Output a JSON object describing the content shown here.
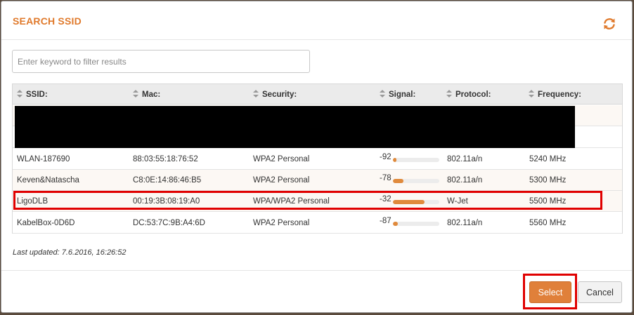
{
  "dialog": {
    "title": "SEARCH SSID",
    "filter_placeholder": "Enter keyword to filter results",
    "columns": {
      "ssid": "SSID:",
      "mac": "Mac:",
      "security": "Security:",
      "signal": "Signal:",
      "protocol": "Protocol:",
      "frequency": "Frequency:"
    },
    "rows": [
      {
        "ssid": "WLAN-187690",
        "mac": "88:03:55:18:76:52",
        "security": "WPA2 Personal",
        "signal": "-92",
        "signal_fill": 0.08,
        "protocol": "802.11a/n",
        "frequency": "5240 MHz"
      },
      {
        "ssid": "Keven&Natascha",
        "mac": "C8:0E:14:86:46:B5",
        "security": "WPA2 Personal",
        "signal": "-78",
        "signal_fill": 0.22,
        "protocol": "802.11a/n",
        "frequency": "5300 MHz"
      },
      {
        "ssid": "LigoDLB",
        "mac": "00:19:3B:08:19:A0",
        "security": "WPA/WPA2 Personal",
        "signal": "-32",
        "signal_fill": 0.68,
        "protocol": "W-Jet",
        "frequency": "5500 MHz"
      },
      {
        "ssid": "KabelBox-0D6D",
        "mac": "DC:53:7C:9B:A4:6D",
        "security": "WPA2 Personal",
        "signal": "-87",
        "signal_fill": 0.1,
        "protocol": "802.11a/n",
        "frequency": "5560 MHz"
      }
    ],
    "last_updated": "Last updated: 7.6.2016, 16:26:52",
    "select_label": "Select",
    "cancel_label": "Cancel",
    "accent_color": "#e0803a",
    "highlight_color": "#e00000"
  }
}
